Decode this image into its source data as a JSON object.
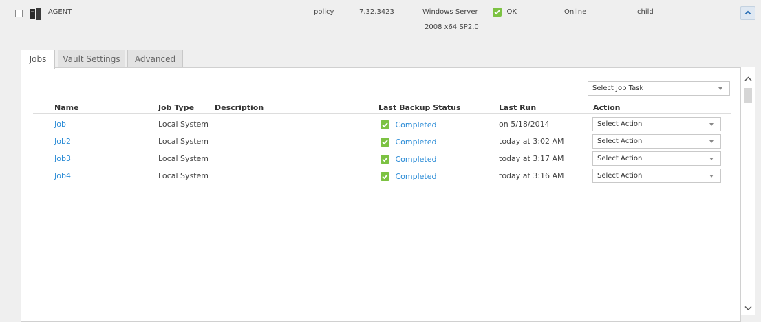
{
  "agent_row": {
    "name": "AGENT",
    "policy": "policy",
    "version": "7.32.3423",
    "os_line1": "Windows Server",
    "os_line2": "2008 x64 SP2.0",
    "status": "OK",
    "connection": "Online",
    "relation": "child"
  },
  "tabs": [
    {
      "label": "Jobs"
    },
    {
      "label": "Vault Settings"
    },
    {
      "label": "Advanced"
    }
  ],
  "job_task_select": {
    "value": "Select Job Task"
  },
  "columns": {
    "name": "Name",
    "job_type": "Job Type",
    "description": "Description",
    "last_backup_status": "Last Backup Status",
    "last_run": "Last Run",
    "action": "Action"
  },
  "jobs": [
    {
      "name": "Job",
      "type": "Local System",
      "description": "",
      "status": "Completed",
      "last_run": "on 5/18/2014",
      "action": "Select Action"
    },
    {
      "name": "Job2",
      "type": "Local System",
      "description": "",
      "status": "Completed",
      "last_run": "today at 3:02 AM",
      "action": "Select Action"
    },
    {
      "name": "Job3",
      "type": "Local System",
      "description": "",
      "status": "Completed",
      "last_run": "today at 3:17 AM",
      "action": "Select Action"
    },
    {
      "name": "Job4",
      "type": "Local System",
      "description": "",
      "status": "Completed",
      "last_run": "today at 3:16 AM",
      "action": "Select Action"
    }
  ],
  "icons": {
    "agent": "server-icon",
    "status_ok": "check-icon",
    "collapse": "chevron-up-icon",
    "scroll_up": "chevron-up-icon",
    "scroll_down": "chevron-down-icon"
  },
  "colors": {
    "link": "#2a8bd6",
    "ok_green": "#7cc242"
  }
}
